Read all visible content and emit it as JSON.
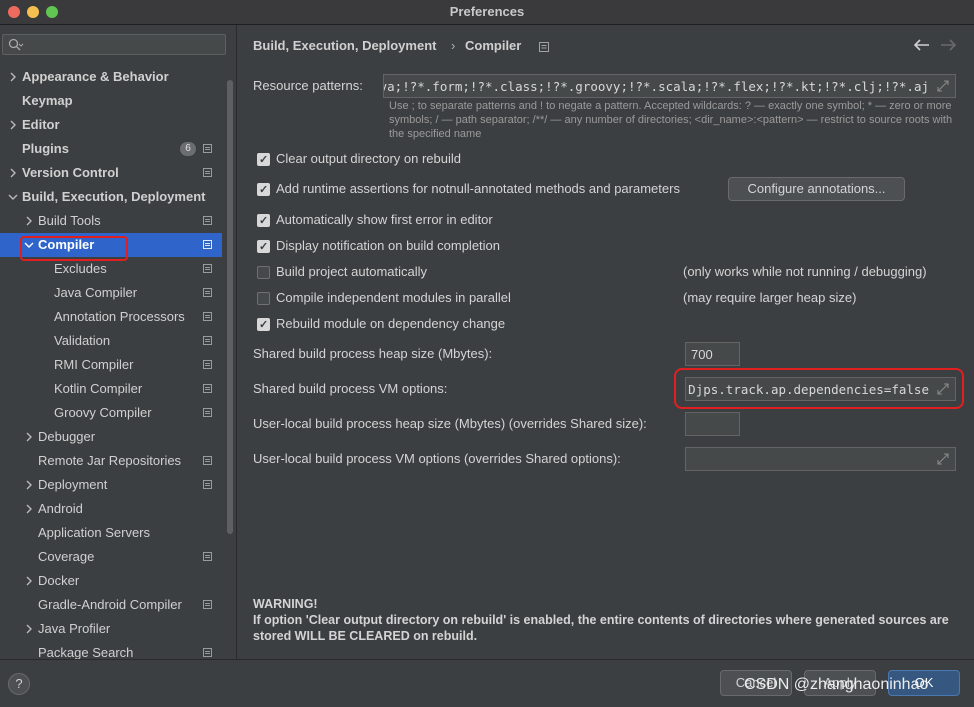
{
  "window": {
    "title": "Preferences"
  },
  "search": {
    "placeholder": ""
  },
  "sidebar": {
    "items": [
      {
        "label": "Appearance & Behavior",
        "expandable": true,
        "expanded": false,
        "bold": true,
        "level": 0
      },
      {
        "label": "Keymap",
        "expandable": false,
        "bold": true,
        "level": 0
      },
      {
        "label": "Editor",
        "expandable": true,
        "expanded": false,
        "bold": true,
        "level": 0
      },
      {
        "label": "Plugins",
        "expandable": false,
        "bold": true,
        "level": 0,
        "badge": "6",
        "project_icon": true
      },
      {
        "label": "Version Control",
        "expandable": true,
        "expanded": false,
        "bold": true,
        "level": 0,
        "project_icon": true
      },
      {
        "label": "Build, Execution, Deployment",
        "expandable": true,
        "expanded": true,
        "bold": true,
        "level": 0
      },
      {
        "label": "Build Tools",
        "expandable": true,
        "expanded": false,
        "level": 1,
        "project_icon": true
      },
      {
        "label": "Compiler",
        "expandable": true,
        "expanded": true,
        "level": 1,
        "selected": true,
        "project_icon": true
      },
      {
        "label": "Excludes",
        "level": 2,
        "project_icon": true
      },
      {
        "label": "Java Compiler",
        "level": 2,
        "project_icon": true
      },
      {
        "label": "Annotation Processors",
        "level": 2,
        "project_icon": true
      },
      {
        "label": "Validation",
        "level": 2,
        "project_icon": true
      },
      {
        "label": "RMI Compiler",
        "level": 2,
        "project_icon": true
      },
      {
        "label": "Kotlin Compiler",
        "level": 2,
        "project_icon": true
      },
      {
        "label": "Groovy Compiler",
        "level": 2,
        "project_icon": true
      },
      {
        "label": "Debugger",
        "expandable": true,
        "expanded": false,
        "level": 1
      },
      {
        "label": "Remote Jar Repositories",
        "level": 1,
        "project_icon": true
      },
      {
        "label": "Deployment",
        "expandable": true,
        "expanded": false,
        "level": 1,
        "project_icon": true
      },
      {
        "label": "Android",
        "expandable": true,
        "expanded": false,
        "level": 1
      },
      {
        "label": "Application Servers",
        "level": 1
      },
      {
        "label": "Coverage",
        "level": 1,
        "project_icon": true
      },
      {
        "label": "Docker",
        "expandable": true,
        "expanded": false,
        "level": 1
      },
      {
        "label": "Gradle-Android Compiler",
        "level": 1,
        "project_icon": true
      },
      {
        "label": "Java Profiler",
        "expandable": true,
        "expanded": false,
        "level": 1
      },
      {
        "label": "Package Search",
        "level": 1,
        "project_icon": true
      }
    ]
  },
  "breadcrumb": {
    "parent": "Build, Execution, Deployment",
    "separator": "›",
    "current": "Compiler"
  },
  "resource_patterns": {
    "label": "Resource patterns:",
    "value": "!?*.java;!?*.form;!?*.class;!?*.groovy;!?*.scala;!?*.flex;!?*.kt;!?*.clj;!?*.aj",
    "hint": "Use ; to separate patterns and ! to negate a pattern. Accepted wildcards: ? — exactly one symbol; * — zero or more symbols; / — path separator; /**/ — any number of directories; <dir_name>:<pattern> — restrict to source roots with the specified name"
  },
  "options": [
    {
      "label": "Clear output directory on rebuild",
      "checked": true
    },
    {
      "label": "Add runtime assertions for notnull-annotated methods and parameters",
      "checked": true
    },
    {
      "label": "Automatically show first error in editor",
      "checked": true
    },
    {
      "label": "Display notification on build completion",
      "checked": true
    },
    {
      "label": "Build project automatically",
      "checked": false,
      "note": "(only works while not running / debugging)"
    },
    {
      "label": "Compile independent modules in parallel",
      "checked": false,
      "note": "(may require larger heap size)"
    },
    {
      "label": "Rebuild module on dependency change",
      "checked": true
    }
  ],
  "configure_annotations_label": "Configure annotations...",
  "fields": {
    "shared_heap": {
      "label": "Shared build process heap size (Mbytes):",
      "value": "700"
    },
    "shared_vm": {
      "label": "Shared build process VM options:",
      "value": "-Djps.track.ap.dependencies=false"
    },
    "user_heap": {
      "label": "User-local build process heap size (Mbytes) (overrides Shared size):",
      "value": ""
    },
    "user_vm": {
      "label": "User-local build process VM options (overrides Shared options):",
      "value": ""
    }
  },
  "warning": {
    "title": "WARNING!",
    "text": "If option 'Clear output directory on rebuild' is enabled, the entire contents of directories where generated sources are stored WILL BE CLEARED on rebuild."
  },
  "footer": {
    "help_label": "?",
    "cancel_label": "Cancel",
    "apply_label": "Apply",
    "ok_label": "OK",
    "watermark": "CSDN @zhanghaoninhao"
  },
  "colors": {
    "selection": "#2f65ca",
    "highlight": "#e02020",
    "ok_button": "#365880"
  }
}
